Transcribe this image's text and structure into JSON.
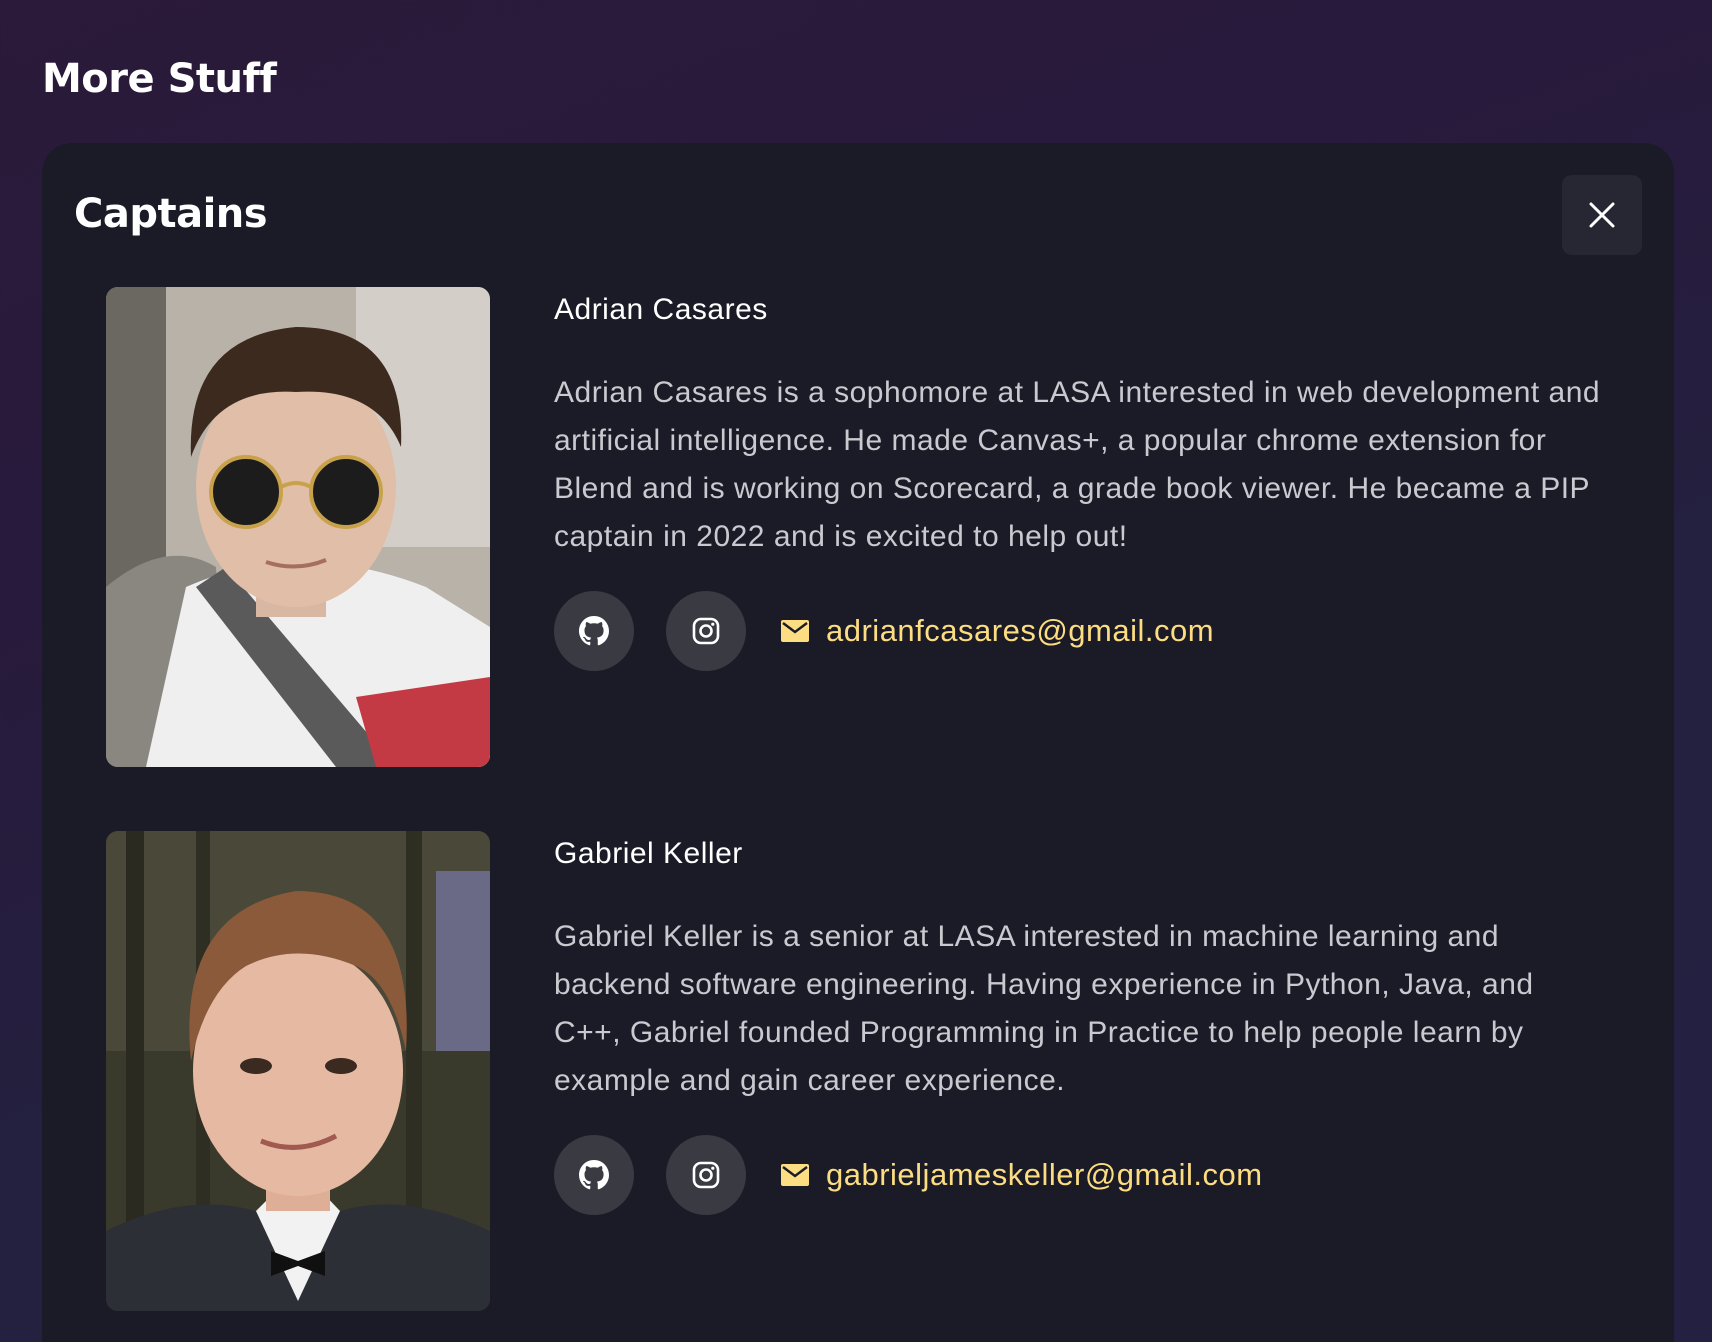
{
  "section": {
    "title": "More Stuff"
  },
  "panel": {
    "title": "Captains",
    "close_icon": "close-icon"
  },
  "colors": {
    "accent": "#fcdd82",
    "panel_bg": "#1a1b26",
    "icon_button_bg": "#393a42",
    "bio_text": "#c9c9cf"
  },
  "captains": [
    {
      "name": "Adrian Casares",
      "bio": "Adrian Casares is a sophomore at LASA interested in web development and artificial intelligence. He made Canvas+, a popular chrome extension for Blend and is working on Scorecard, a grade book viewer. He became a PIP captain in 2022 and is excited to help out!",
      "email": "adrianfcasares@gmail.com",
      "icons": [
        "github-icon",
        "instagram-icon",
        "mail-icon"
      ]
    },
    {
      "name": "Gabriel Keller",
      "bio": "Gabriel Keller is a senior at LASA interested in machine learning and backend software engineering. Having experience in Python, Java, and C++, Gabriel founded Programming in Practice to help people learn by example and gain career experience.",
      "email": "gabrieljameskeller@gmail.com",
      "icons": [
        "github-icon",
        "instagram-icon",
        "mail-icon"
      ]
    }
  ]
}
